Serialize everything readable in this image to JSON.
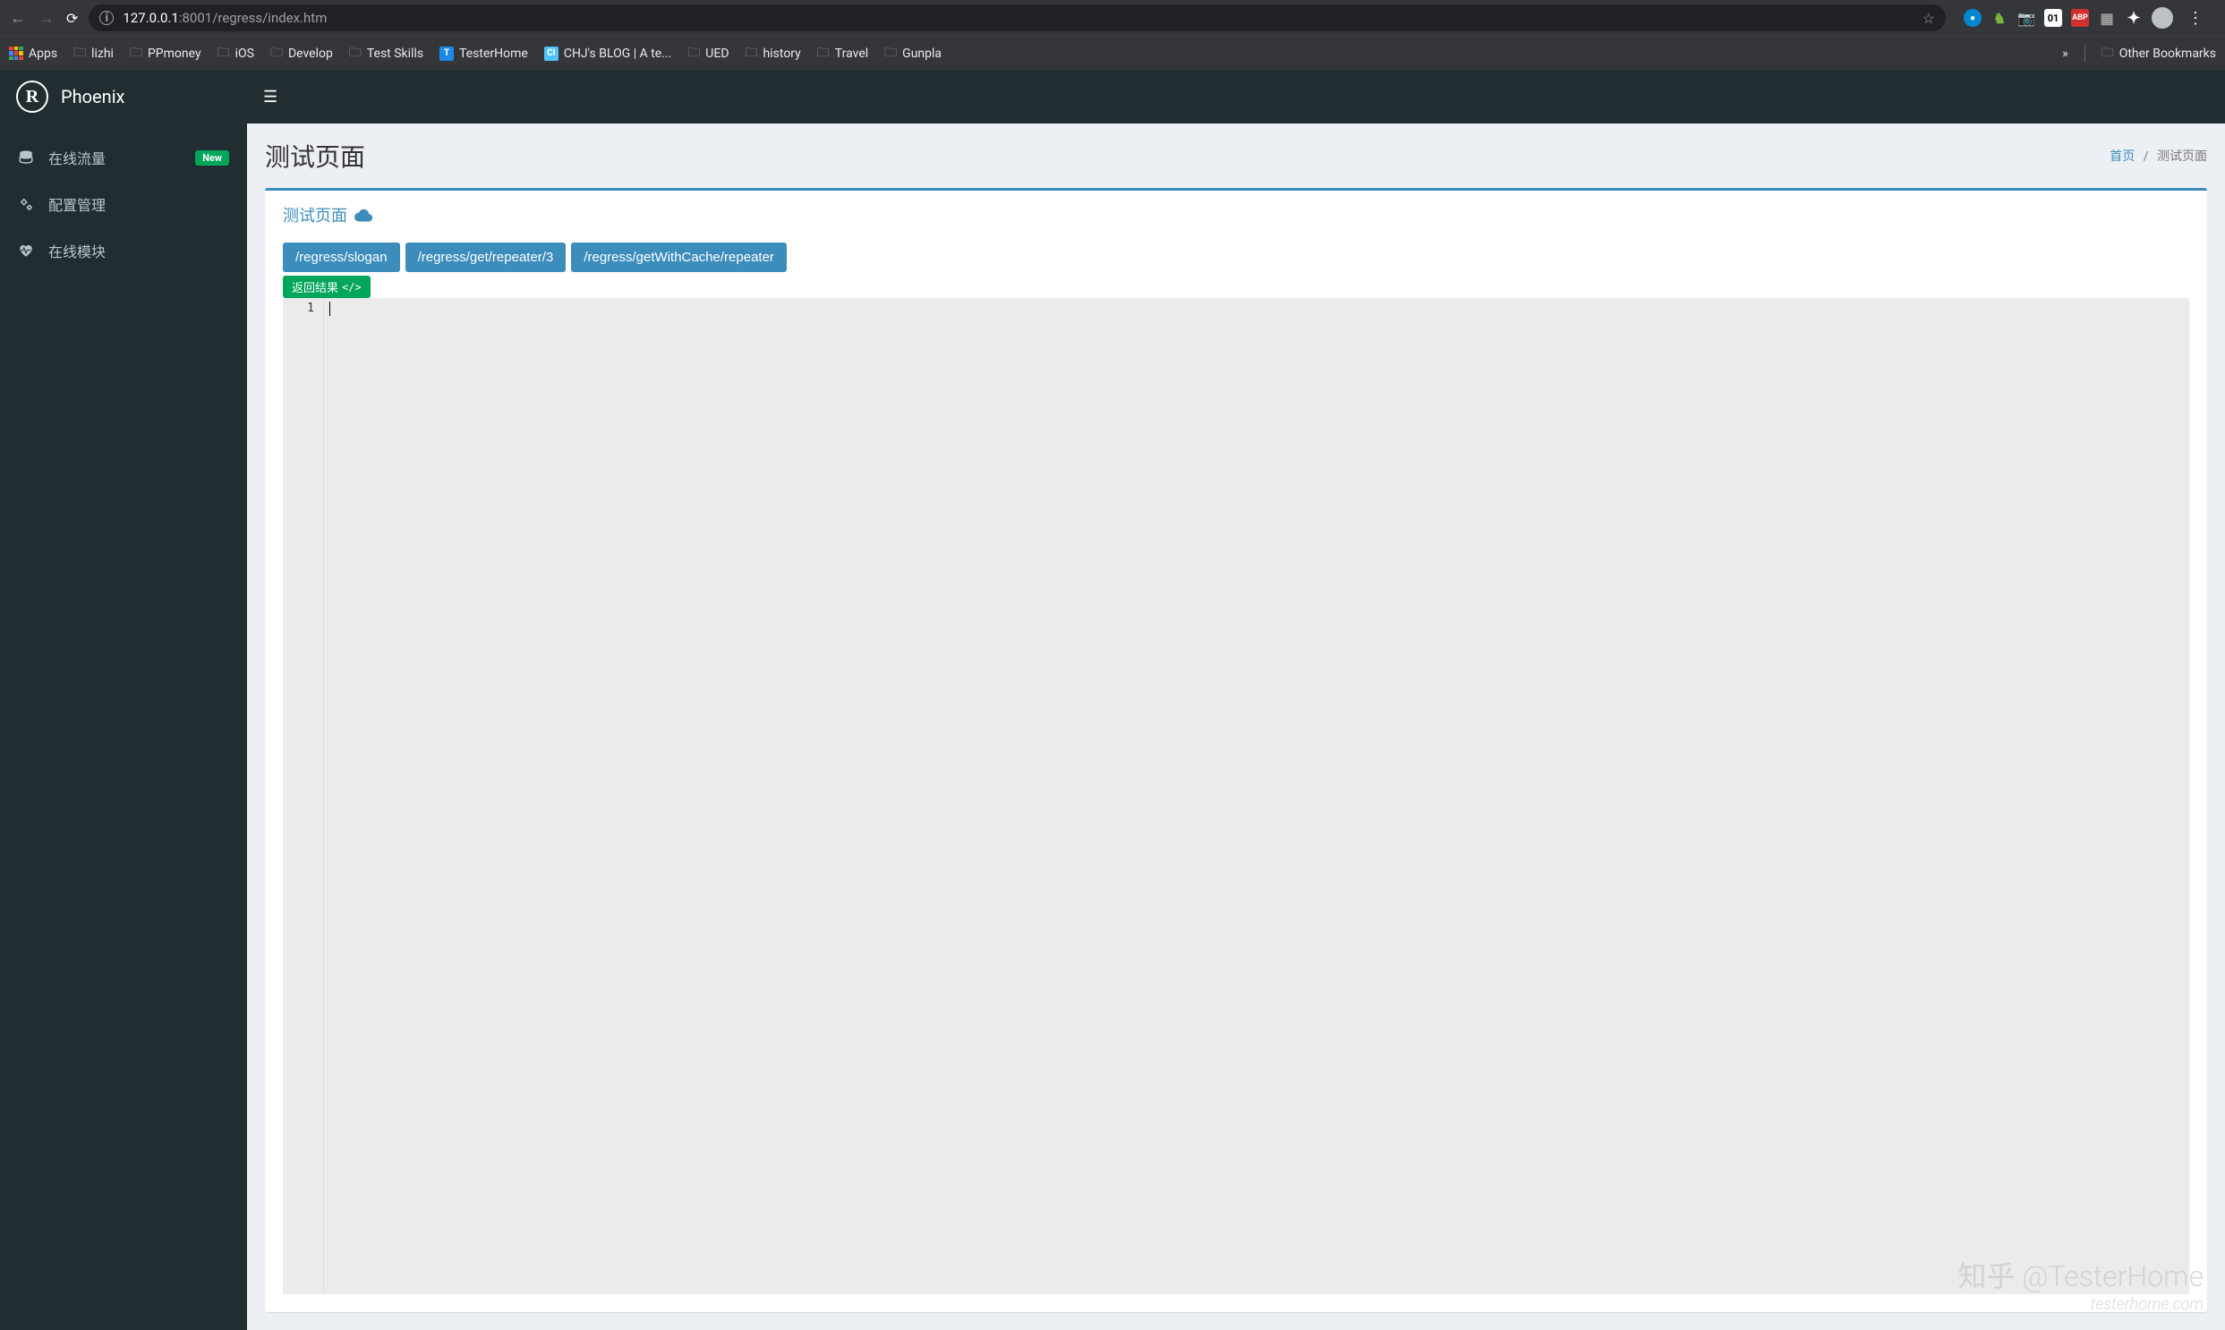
{
  "browser": {
    "url_host": "127.0.0.1",
    "url_port": ":8001",
    "url_path": "/regress/index.htm",
    "apps_label": "Apps",
    "badge_01": "01",
    "other_bookmarks": "Other Bookmarks",
    "bookmarks": [
      {
        "label": "lizhi",
        "type": "folder"
      },
      {
        "label": "PPmoney",
        "type": "folder"
      },
      {
        "label": "iOS",
        "type": "folder"
      },
      {
        "label": "Develop",
        "type": "folder"
      },
      {
        "label": "Test Skills",
        "type": "folder"
      },
      {
        "label": "TesterHome",
        "type": "favicon",
        "color": "#1e88e5",
        "initial": "T"
      },
      {
        "label": "CHJ's BLOG | A te...",
        "type": "favicon",
        "color": "#4fc3f7",
        "initial": "CI"
      },
      {
        "label": "UED",
        "type": "folder"
      },
      {
        "label": "history",
        "type": "folder"
      },
      {
        "label": "Travel",
        "type": "folder"
      },
      {
        "label": "Gunpla",
        "type": "folder"
      }
    ]
  },
  "sidebar": {
    "brand": "Phoenix",
    "items": [
      {
        "label": "在线流量",
        "badge": "New"
      },
      {
        "label": "配置管理"
      },
      {
        "label": "在线模块"
      }
    ]
  },
  "page": {
    "title": "测试页面",
    "breadcrumb_home": "首页",
    "breadcrumb_current": "测试页面",
    "box_title": "测试页面",
    "api_buttons": [
      "/regress/slogan",
      "/regress/get/repeater/3",
      "/regress/getWithCache/repeater"
    ],
    "result_label": "返回结果",
    "editor_line1": "1"
  },
  "watermark": {
    "main": "知乎 @TesterHome",
    "sub": "testerhome.com"
  }
}
